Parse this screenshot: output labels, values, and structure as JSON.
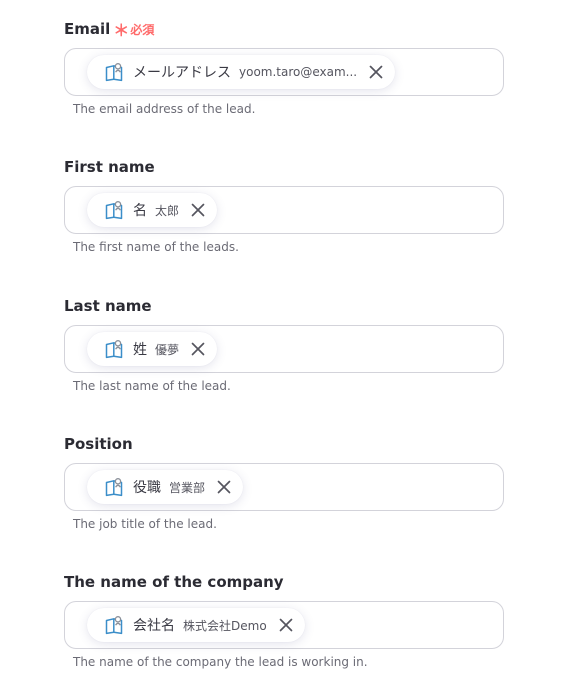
{
  "fields": [
    {
      "label": "Email",
      "required_mark": "＊",
      "required_text": "必須",
      "chip_name": "メールアドレス",
      "chip_value": "yoom.taro@exam...",
      "help": "The email address of the lead."
    },
    {
      "label": "First name",
      "chip_name": "名",
      "chip_value": "太郎",
      "help": "The first name of the leads."
    },
    {
      "label": "Last name",
      "chip_name": "姓",
      "chip_value": "優夢",
      "help": "The last name of the lead."
    },
    {
      "label": "Position",
      "chip_name": "役職",
      "chip_value": "営業部",
      "help": "The job title of the lead."
    },
    {
      "label": "The name of the company",
      "chip_name": "会社名",
      "chip_value": "株式会社Demo",
      "help": "The name of the company the lead is working in."
    }
  ],
  "colors": {
    "required": "#ff6b6b",
    "icon_primary": "#3b8ec9",
    "icon_secondary": "#8a8f99",
    "border": "#d3d3da"
  },
  "icons": {
    "chip_icon": "book-person-icon",
    "remove_icon": "close-icon"
  }
}
